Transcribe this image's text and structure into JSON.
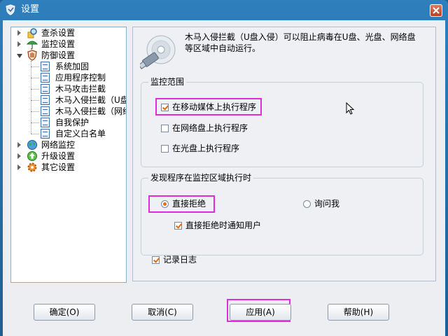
{
  "window": {
    "title": "设置"
  },
  "tree": {
    "items": [
      {
        "label": "查杀设置",
        "level": 0,
        "state": "collapsed"
      },
      {
        "label": "监控设置",
        "level": 0,
        "state": "collapsed"
      },
      {
        "label": "防御设置",
        "level": 0,
        "state": "expanded"
      },
      {
        "label": "系统加固",
        "level": 1
      },
      {
        "label": "应用程序控制",
        "level": 1
      },
      {
        "label": "木马攻击拦截",
        "level": 1
      },
      {
        "label": "木马入侵拦截（U盘",
        "level": 1,
        "selected": true
      },
      {
        "label": "木马入侵拦截（网络",
        "level": 1
      },
      {
        "label": "自我保护",
        "level": 1
      },
      {
        "label": "自定义白名单",
        "level": 1
      },
      {
        "label": "网络监控",
        "level": 0,
        "state": "collapsed"
      },
      {
        "label": "升级设置",
        "level": 0,
        "state": "collapsed"
      },
      {
        "label": "其它设置",
        "level": 0,
        "state": "collapsed"
      }
    ]
  },
  "content": {
    "description": "木马入侵拦截（U盘入侵）可以阻止病毒在U盘、光盘、网络盘等区域中自动运行。",
    "monitor_scope": {
      "title": "监控范围",
      "options": [
        {
          "label": "在移动媒体上执行程序",
          "checked": true
        },
        {
          "label": "在网络盘上执行程序",
          "checked": false
        },
        {
          "label": "在光盘上执行程序",
          "checked": false
        }
      ]
    },
    "on_detect": {
      "title": "发现程序在监控区域执行时",
      "deny_label": "直接拒绝",
      "deny_selected": true,
      "ask_label": "询问我",
      "ask_selected": false,
      "notify_label": "直接拒绝时通知用户",
      "notify_checked": true
    },
    "log": {
      "label": "记录日志",
      "checked": true
    }
  },
  "buttons": {
    "ok": "确定(O)",
    "cancel": "取消(C)",
    "apply": "应用(A)",
    "help": "帮助(H)"
  }
}
